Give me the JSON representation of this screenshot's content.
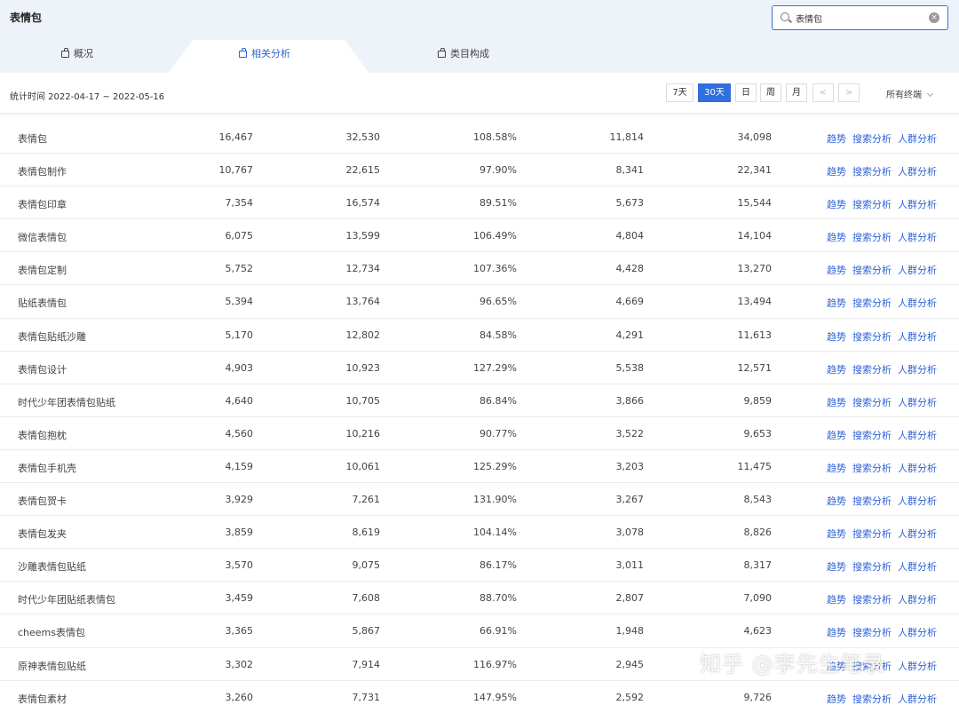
{
  "header": {
    "title": "表情包",
    "search": {
      "value": "表情包",
      "placeholder": ""
    }
  },
  "tabs": [
    {
      "label": "概况",
      "active": false
    },
    {
      "label": "相关分析",
      "active": true
    },
    {
      "label": "类目构成",
      "active": false
    }
  ],
  "toolbar": {
    "period_text": "统计时间 2022-04-17 ~ 2022-05-16",
    "periods": [
      "7天",
      "30天",
      "日",
      "周",
      "月"
    ],
    "active_period": "30天",
    "prev": "<",
    "next": ">",
    "terminal_select": "所有终端"
  },
  "actions": [
    "趋势",
    "搜索分析",
    "人群分析"
  ],
  "rows": [
    [
      "表情包",
      "16,467",
      "32,530",
      "108.58%",
      "11,814",
      "34,098"
    ],
    [
      "表情包制作",
      "10,767",
      "22,615",
      "97.90%",
      "8,341",
      "22,341"
    ],
    [
      "表情包印章",
      "7,354",
      "16,574",
      "89.51%",
      "5,673",
      "15,544"
    ],
    [
      "微信表情包",
      "6,075",
      "13,599",
      "106.49%",
      "4,804",
      "14,104"
    ],
    [
      "表情包定制",
      "5,752",
      "12,734",
      "107.36%",
      "4,428",
      "13,270"
    ],
    [
      "贴纸表情包",
      "5,394",
      "13,764",
      "96.65%",
      "4,669",
      "13,494"
    ],
    [
      "表情包贴纸沙雕",
      "5,170",
      "12,802",
      "84.58%",
      "4,291",
      "11,613"
    ],
    [
      "表情包设计",
      "4,903",
      "10,923",
      "127.29%",
      "5,538",
      "12,571"
    ],
    [
      "时代少年团表情包贴纸",
      "4,640",
      "10,705",
      "86.84%",
      "3,866",
      "9,859"
    ],
    [
      "表情包抱枕",
      "4,560",
      "10,216",
      "90.77%",
      "3,522",
      "9,653"
    ],
    [
      "表情包手机壳",
      "4,159",
      "10,061",
      "125.29%",
      "3,203",
      "11,475"
    ],
    [
      "表情包贺卡",
      "3,929",
      "7,261",
      "131.90%",
      "3,267",
      "8,543"
    ],
    [
      "表情包发夹",
      "3,859",
      "8,619",
      "104.14%",
      "3,078",
      "8,826"
    ],
    [
      "沙雕表情包贴纸",
      "3,570",
      "9,075",
      "86.17%",
      "3,011",
      "8,317"
    ],
    [
      "时代少年团贴纸表情包",
      "3,459",
      "7,608",
      "88.70%",
      "2,807",
      "7,090"
    ],
    [
      "cheems表情包",
      "3,365",
      "5,867",
      "66.91%",
      "1,948",
      "4,623"
    ],
    [
      "原神表情包贴纸",
      "3,302",
      "7,914",
      "116.97%",
      "2,945",
      ""
    ],
    [
      "表情包素材",
      "3,260",
      "7,731",
      "147.95%",
      "2,592",
      "9,726"
    ]
  ],
  "watermark": "知乎 @李先生笔录"
}
